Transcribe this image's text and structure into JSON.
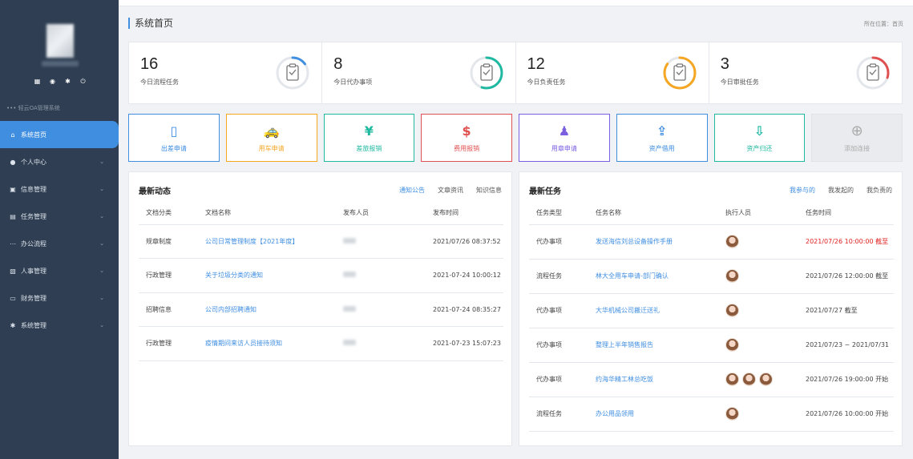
{
  "sidebar": {
    "system_title": "••• 轻云OA管理系统",
    "quick_icons": [
      "grid-icon",
      "user-icon",
      "gear-icon",
      "power-icon"
    ],
    "items": [
      {
        "label": "系统首页",
        "icon": "home-icon",
        "active": true
      },
      {
        "label": "个人中心",
        "icon": "user-icon"
      },
      {
        "label": "信息管理",
        "icon": "info-icon"
      },
      {
        "label": "任务管理",
        "icon": "task-icon"
      },
      {
        "label": "办公流程",
        "icon": "flow-icon"
      },
      {
        "label": "人事管理",
        "icon": "hr-icon"
      },
      {
        "label": "财务管理",
        "icon": "finance-icon"
      },
      {
        "label": "系统管理",
        "icon": "gear-icon"
      }
    ]
  },
  "header": {
    "title": "系统首页",
    "location": "所在位置：首页"
  },
  "stats": [
    {
      "value": "16",
      "label": "今日流程任务",
      "color": "#3f8ee0",
      "ratio": 0.15
    },
    {
      "value": "8",
      "label": "今日代办事项",
      "color": "#1fb8a0",
      "ratio": 0.55
    },
    {
      "value": "12",
      "label": "今日负责任务",
      "color": "#f5a623",
      "ratio": 0.85
    },
    {
      "value": "3",
      "label": "今日审批任务",
      "color": "#e05050",
      "ratio": 0.3
    }
  ],
  "shortcuts": [
    {
      "label": "出差申请",
      "color": "#3f8ee0",
      "icon": "travel-icon"
    },
    {
      "label": "用车申请",
      "color": "#f5a623",
      "icon": "car-icon"
    },
    {
      "label": "差旅报销",
      "color": "#1fb8a0",
      "icon": "reimburse-icon"
    },
    {
      "label": "费用报销",
      "color": "#e05050",
      "icon": "expense-icon"
    },
    {
      "label": "用章申请",
      "color": "#7b5fe0",
      "icon": "stamp-icon"
    },
    {
      "label": "资产借用",
      "color": "#3f8ee0",
      "icon": "asset-borrow-icon"
    },
    {
      "label": "资产归还",
      "color": "#1fb8a0",
      "icon": "asset-return-icon"
    },
    {
      "label": "添加连接",
      "color": "#aaaaaa",
      "icon": "plus-icon"
    }
  ],
  "news": {
    "title": "最新动态",
    "tabs": [
      "通知公告",
      "文章资讯",
      "知识信息"
    ],
    "columns": [
      "文档分类",
      "文档名称",
      "发布人员",
      "发布时间"
    ],
    "rows": [
      {
        "category": "规章制度",
        "name": "公司日常管理制度【2021年度】",
        "time": "2021/07/26  08:37:52"
      },
      {
        "category": "行政管理",
        "name": "关于垃圾分类的通知",
        "time": "2021-07-24  10:00:12"
      },
      {
        "category": "招聘信息",
        "name": "公司内部招聘通知",
        "time": "2021-07-24  08:35:27"
      },
      {
        "category": "行政管理",
        "name": "疫情期间来访人员接待须知",
        "time": "2021-07-23  15:07:23"
      }
    ]
  },
  "tasks": {
    "title": "最新任务",
    "tabs": [
      "我参与的",
      "我发起的",
      "我负责的"
    ],
    "columns": [
      "任务类型",
      "任务名称",
      "执行人员",
      "任务时间"
    ],
    "rows": [
      {
        "type": "代办事项",
        "name": "发送海信刘总设备操作手册",
        "people": 1,
        "time": "2021/07/26  10:00:00  截至",
        "urgent": true
      },
      {
        "type": "流程任务",
        "name": "林大全用车申请-部门确认",
        "people": 1,
        "time": "2021/07/26  12:00:00  截至"
      },
      {
        "type": "代办事项",
        "name": "大华机械公司搬迁送礼",
        "people": 1,
        "time": "2021/07/27    截至"
      },
      {
        "type": "代办事项",
        "name": "整理上半年销售报告",
        "people": 1,
        "time": "2021/07/23 ~ 2021/07/31"
      },
      {
        "type": "代办事项",
        "name": "约海华精工林总吃饭",
        "people": 3,
        "time": "2021/07/26  19:00:00  开始"
      },
      {
        "type": "流程任务",
        "name": "办公用品领用",
        "people": 1,
        "time": "2021/07/26  10:00:00  开始"
      }
    ]
  }
}
